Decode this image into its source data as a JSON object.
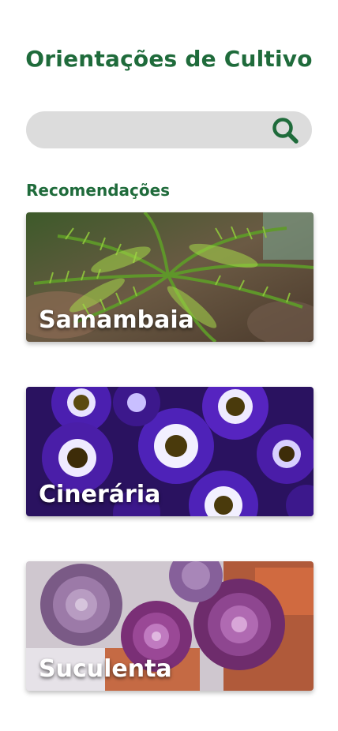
{
  "header": {
    "title": "Orientações de Cultivo"
  },
  "search": {
    "placeholder": "",
    "value": "",
    "icon": "search-icon"
  },
  "recommendations": {
    "label": "Recomendações",
    "items": [
      {
        "name": "Samambaia"
      },
      {
        "name": "Cinerária"
      },
      {
        "name": "Suculenta"
      }
    ]
  },
  "colors": {
    "brand": "#1f6b3b",
    "search_bg": "#dcdcdc"
  }
}
